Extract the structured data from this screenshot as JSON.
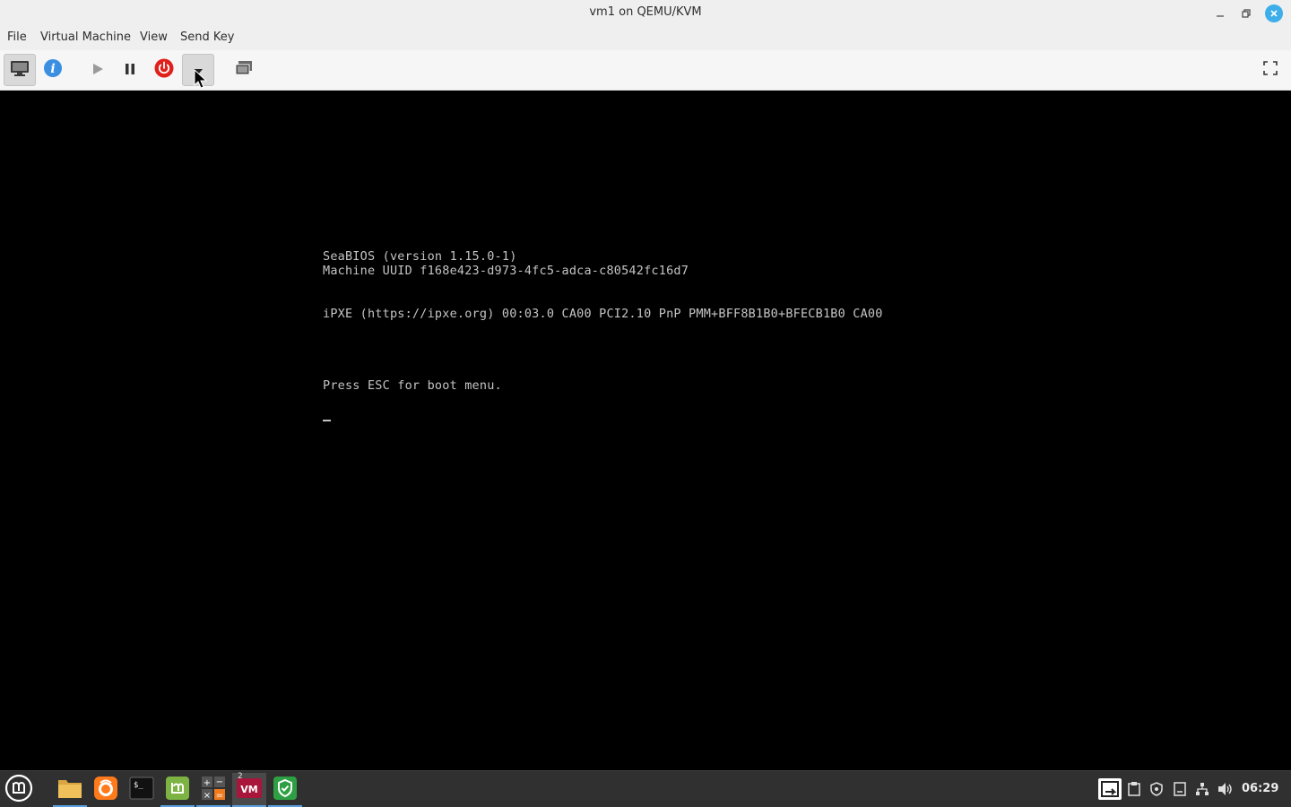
{
  "window": {
    "title": "vm1 on QEMU/KVM",
    "minimize_icon": "minimize-icon",
    "restore_icon": "restore-icon",
    "close_icon": "close-icon"
  },
  "menubar": {
    "items": [
      "File",
      "Virtual Machine",
      "View",
      "Send Key"
    ]
  },
  "toolbar": {
    "buttons": [
      {
        "icon": "monitor-icon",
        "tooltip": "Show the graphical console"
      },
      {
        "icon": "info-icon"
      },
      {
        "icon": "play-icon"
      },
      {
        "icon": "pause-icon"
      },
      {
        "icon": "power-icon",
        "color": "#e0201b"
      },
      {
        "icon": "chevron-down-icon"
      },
      {
        "icon": "snapshots-icon"
      },
      {
        "icon": "fullscreen-icon"
      }
    ]
  },
  "console": {
    "lines": [
      "SeaBIOS (version 1.15.0-1)",
      "Machine UUID f168e423-d973-4fc5-adca-c80542fc16d7",
      "iPXE (https://ipxe.org) 00:03.0 CA00 PCI2.10 PnP PMM+BFF8B1B0+BFECB1B0 CA00",
      "Press ESC for boot menu."
    ]
  },
  "taskbar": {
    "apps": [
      {
        "icon": "mint-menu-icon"
      },
      {
        "icon": "files-folder-icon"
      },
      {
        "icon": "firefox-icon"
      },
      {
        "icon": "terminal-icon"
      },
      {
        "icon": "mintinstall-icon"
      },
      {
        "icon": "calculator-icon"
      },
      {
        "icon": "virt-manager-icon",
        "badge": "2"
      },
      {
        "icon": "shield-icon"
      }
    ],
    "tray": [
      "session-icon",
      "clipboard-icon",
      "security-shield-icon",
      "document-icon",
      "network-icon",
      "volume-icon"
    ],
    "clock": "06:29"
  },
  "colors": {
    "accent": "#3daee9",
    "console_bg": "#000000",
    "console_text": "#c4c4c4",
    "taskbar": "#303030"
  }
}
